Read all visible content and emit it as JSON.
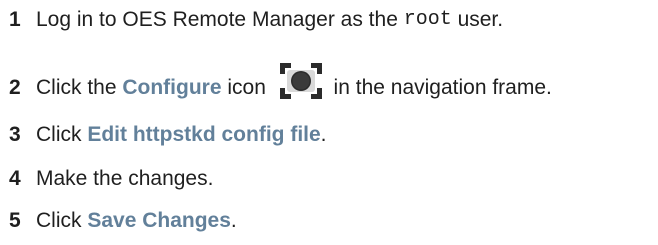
{
  "steps": [
    {
      "number": "1",
      "prefix": "Log in to OES Remote Manager as the ",
      "code": "root",
      "suffix": " user."
    },
    {
      "number": "2",
      "prefix": "Click the ",
      "keyword": "Configure",
      "middle": " icon ",
      "icon": "configure-icon",
      "suffix": " in the navigation frame."
    },
    {
      "number": "3",
      "prefix": "Click ",
      "keyword": "Edit httpstkd config file",
      "suffix": "."
    },
    {
      "number": "4",
      "text": "Make the changes."
    },
    {
      "number": "5",
      "prefix": "Click ",
      "keyword": "Save Changes",
      "suffix": "."
    }
  ],
  "colors": {
    "text": "#1f1f1f",
    "keyword": "#62809a",
    "icon_dark": "#2b2b2b",
    "icon_light": "#d9d9d9"
  }
}
